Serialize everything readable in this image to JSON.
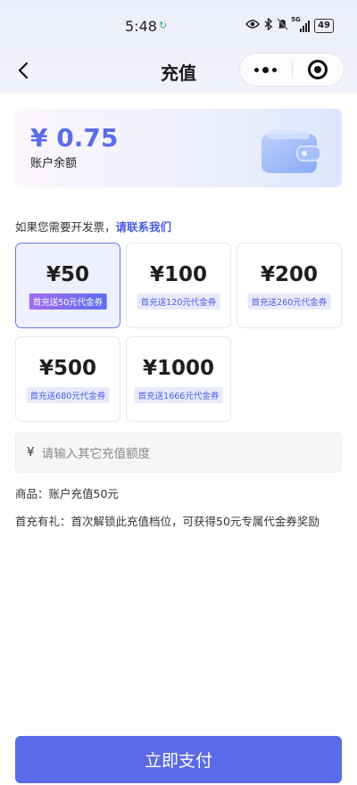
{
  "status_bar": {
    "time": "5:48",
    "battery": "49",
    "network": "5G"
  },
  "nav": {
    "title": "充值"
  },
  "balance": {
    "amount": "¥ 0.75",
    "label": "账户余额"
  },
  "invoice": {
    "text": "如果您需要开发票，",
    "link": "请联系我们"
  },
  "plans": [
    {
      "price": "¥50",
      "bonus": "首充送50元代金券",
      "selected": true
    },
    {
      "price": "¥100",
      "bonus": "首充送120元代金券",
      "selected": false
    },
    {
      "price": "¥200",
      "bonus": "首充送260元代金券",
      "selected": false
    },
    {
      "price": "¥500",
      "bonus": "首充送680元代金券",
      "selected": false
    },
    {
      "price": "¥1000",
      "bonus": "首充送1666元代金券",
      "selected": false
    }
  ],
  "custom_amount": {
    "currency": "¥",
    "placeholder": "请输入其它充值额度"
  },
  "product": {
    "text": "商品：账户充值50元"
  },
  "gift": {
    "text": "首充有礼：首次解锁此充值档位，可获得50元专属代金券奖励"
  },
  "pay": {
    "label": "立即支付"
  },
  "colors": {
    "accent": "#5a6ae8",
    "balance": "#5b6ce9",
    "link": "#4a5ee3"
  }
}
